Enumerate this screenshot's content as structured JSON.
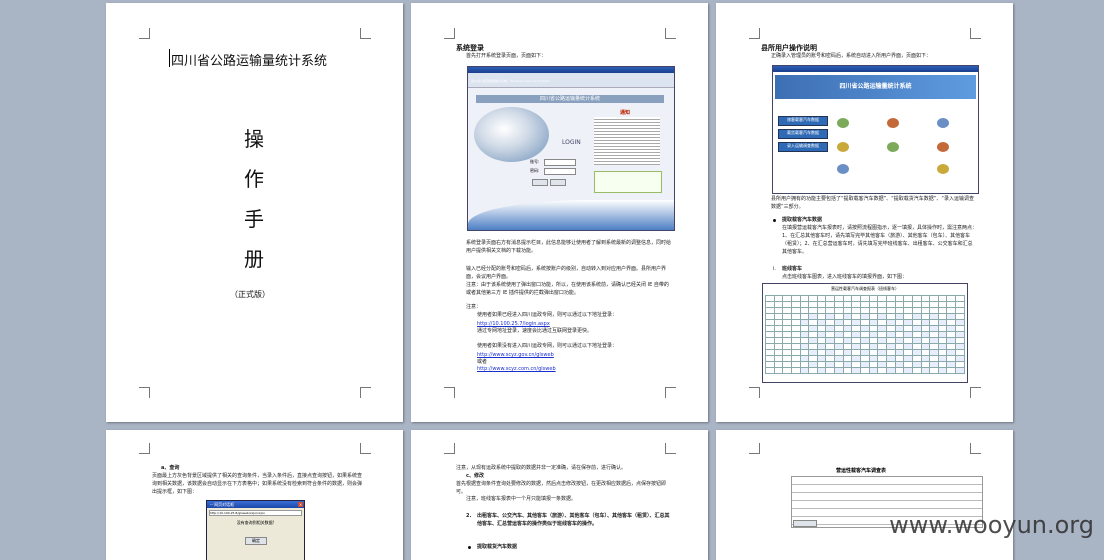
{
  "page1": {
    "title": "四川省公路运输量统计系统",
    "manual_chars": [
      "操",
      "作",
      "手",
      "册"
    ],
    "edition": "（正式版）"
  },
  "page2": {
    "heading": "系统登录",
    "intro": "首先打开系统登录页面，页面如下：",
    "browser_title": "四川省公路运输量统计系统 - Windows Internet Explorer",
    "banner": "四川省公路运输量统计系统",
    "login_word": "LOGIN",
    "notice_title": "通知",
    "user_label": "账号:",
    "pass_label": "密码:",
    "para1": "系统登录页面右方有消息提示栏目，此信息能够让使用者了解到系统最新的调整信息，同时给用户提供相关文档的下载功能。",
    "para2": "输入已经分配的账号和密码后，系统按账户的级别，自动转入到对应用户界面。县所用户界面，会议用户界面。",
    "para3": "注意：由于该系统使用了弹出窗口功能，所以，在使用该系统前，请确认已经关闭 IE 自带的或者其他第三方 IE 插件提供的拦截弹出窗口功能。",
    "note_label": "注意：",
    "note1": "使用者如果已经进入四川运政专网，则可以通过以下地址登录：",
    "link1": "http://10.100.25.7/login.aspx",
    "note2": "通过专网地址登录，速度会比通过互联网登录更快。",
    "note3": "使用者如果没有进入四川运政专网，则可以通过以下地址登录：",
    "link2": "http://www.scyz.gov.cn/glsweb",
    "or": "或者",
    "link3": "http://www.scyz.com.cn/glsweb"
  },
  "page3": {
    "heading": "县所用户操作说明",
    "intro": "正确录入管理员的账号和密码后，系统自动进入所用户界面，页面如下：",
    "banner": "四川省公路运输量统计系统",
    "menu": [
      "旅客载客汽车数据",
      "载货载客汽车数据",
      "录入运输调查数据"
    ],
    "para1": "县所用户拥有的功能主要包括了“提取载客汽车数据”、“提取载货汽车数据”、“录入运输调查数据”三部分。",
    "bullet1": "提取载客汽车数据",
    "bullet1_text": "在填报营运载客汽车报表时，请按照流程图指示，逐一填报，具体操作时，需注意两点：1、在汇总其他客车时，请先填写完毕其他客车（旅游）、其他客车（包车）、其他客车（租赁）；2、在汇总营运客车时，请先填写完毕班线客车、出租客车、公交客车和汇总其他客车。",
    "sub_label": "i.",
    "sub_heading": "班线客车",
    "sub_text": "点击班线客车图表，进入班线客车的填报界面，如下图：",
    "table_title": "营运性载客汽车调查报表（班线客车）"
  },
  "page4": {
    "section": "a、查询",
    "text": "页面最上方灰色背景区域提供了相关的查询条件，当录入条件后，直接点查询按钮，如果系统查询到相关数据，该数据会自动显示在下方表格中；如果系统没有检索到符合条件的数据，则会弹出提示框，如下图：",
    "dialog_title": "-- 网页对话框",
    "dialog_url": "http://10.100.25.8/glsweb/xxjx/xxjxx",
    "dialog_msg": "没有查询到相关数据!",
    "dialog_ok": "确定"
  },
  "page5": {
    "line1": "注意，从现有运政系统中提取的数据并非一定准确，请在保存前，进行确认。",
    "section": "c、修改",
    "text1": "首先根据查询条件查询处要修改的数据，然后点击修改按钮，在更改相应数据后，点保存按钮即可。",
    "text2": "注意，班线客车报表中一个月只能填报一条数据。",
    "item2_label": "2.",
    "item2": "出租客车、公交汽车、其他客车（旅游）、其他客车（包车）、其他客车（租赁）、汇总其他客车、汇总营运客车的操作类似于班线客车的操作。",
    "bullet": "提取载货汽车数据"
  },
  "page6": {
    "form_title": "营运性载客汽车调查表"
  },
  "watermark": "www.wooyun.org"
}
